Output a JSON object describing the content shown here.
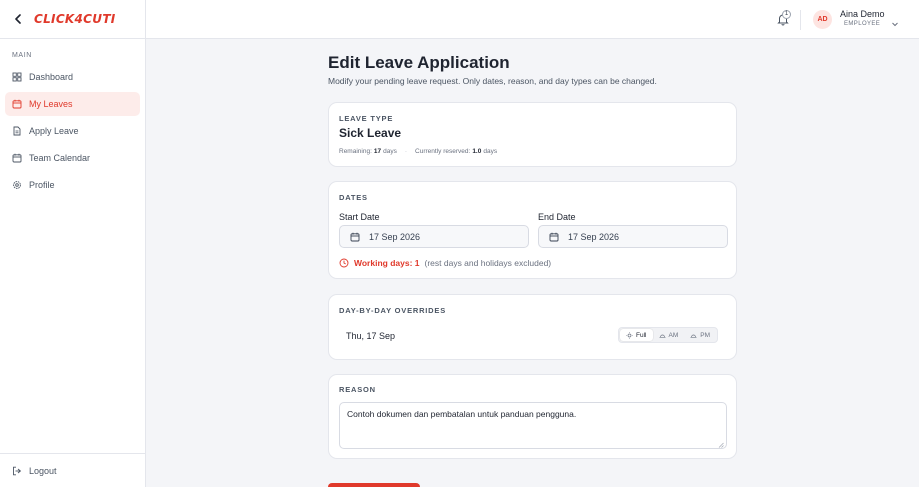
{
  "colors": {
    "accent": "#e0392b",
    "accent_soft": "#fdecea",
    "text": "#1f2430",
    "muted": "#6b7280",
    "border": "#e4e6ec",
    "background": "#f4f5f8"
  },
  "brand": {
    "logo_text": "CLICK4CUTI",
    "back_icon": "chevron-left-icon"
  },
  "sidebar": {
    "section_label": "MAIN",
    "items": [
      {
        "label": "Dashboard",
        "icon": "grid-icon",
        "active": false
      },
      {
        "label": "My Leaves",
        "icon": "calendar-icon",
        "active": true
      },
      {
        "label": "Apply Leave",
        "icon": "document-icon",
        "active": false
      },
      {
        "label": "Team Calendar",
        "icon": "calendar-icon",
        "active": false
      },
      {
        "label": "Profile",
        "icon": "gear-icon",
        "active": false
      }
    ],
    "logout_label": "Logout"
  },
  "topbar": {
    "notification_count": "1",
    "avatar_initials": "AD",
    "user_name": "Aina Demo",
    "user_role": "EMPLOYEE"
  },
  "page": {
    "title": "Edit Leave Application",
    "subtitle": "Modify your pending leave request. Only dates, reason, and day types can be changed."
  },
  "leave_type": {
    "caption": "LEAVE TYPE",
    "name": "Sick Leave",
    "remaining_label": "Remaining:",
    "remaining_value": "17",
    "remaining_unit": "days",
    "reserved_label": "Currently reserved:",
    "reserved_value": "1.0",
    "reserved_unit": "days"
  },
  "dates": {
    "caption": "DATES",
    "start_label": "Start Date",
    "start_value": "17 Sep 2026",
    "end_label": "End Date",
    "end_value": "17 Sep 2026",
    "working_days_label": "Working days: 1",
    "working_days_note": "(rest days and holidays excluded)"
  },
  "overrides": {
    "caption": "DAY-BY-DAY OVERRIDES",
    "days": [
      {
        "label": "Thu, 17 Sep",
        "options": [
          "Full",
          "AM",
          "PM"
        ],
        "selected": "Full"
      }
    ]
  },
  "reason": {
    "caption": "REASON",
    "value": "Contoh dokumen dan pembatalan untuk panduan pengguna."
  }
}
